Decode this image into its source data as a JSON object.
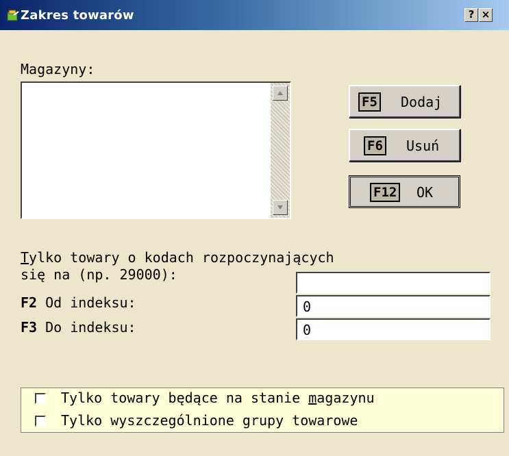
{
  "window": {
    "title": "Zakres towarów",
    "help_label": "?",
    "close_label": "×"
  },
  "magazyny_label": "Magazyny:",
  "buttons": {
    "dodaj": {
      "key": "F5",
      "label": "Dodaj"
    },
    "usun": {
      "key": "F6",
      "label": "Usuń"
    },
    "ok": {
      "key": "F12",
      "label": "OK"
    }
  },
  "filter": {
    "line1_mnemonic": "T",
    "line1_rest": "ylko towary o kodach rozpoczynających",
    "line2": "się na (np. 29000):",
    "prefix_value": "",
    "od_key": "F2",
    "od_label": "Od indeksu:",
    "od_value": "0",
    "do_key": "F3",
    "do_label": "Do indeksu:",
    "do_value": "0"
  },
  "checkboxes": {
    "stan": {
      "before": "Tylko towary będące na stanie ",
      "mnemonic": "m",
      "after": "agazynu",
      "checked": false
    },
    "grupy": {
      "label": "Tylko wyszczególnione grupy towarowe",
      "checked": false
    }
  }
}
